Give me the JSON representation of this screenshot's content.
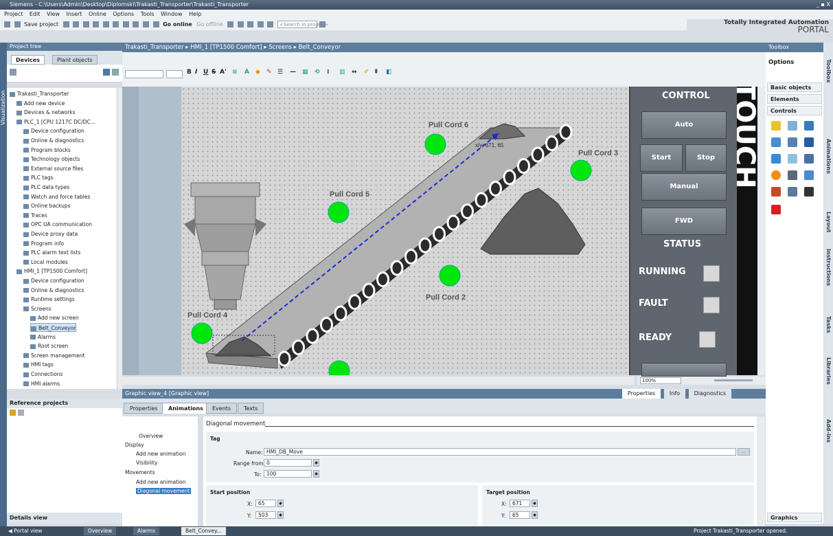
{
  "window": {
    "title": "Siemens - C:\\Users\\Admin\\Desktop\\Diplomski\\Trakasti_Transporter\\Trakasti_Transporter",
    "controls": "_ ▪ X"
  },
  "menu": [
    "Project",
    "Edit",
    "View",
    "Insert",
    "Online",
    "Options",
    "Tools",
    "Window",
    "Help"
  ],
  "toolbar": {
    "save": "Save project",
    "go_online": "Go online",
    "go_offline": "Go offline",
    "search_placeholder": "<Search in project>"
  },
  "branding": {
    "line1": "Totally Integrated Automation",
    "line2": "PORTAL"
  },
  "left_strip": "Visualization",
  "project_tree": {
    "title": "Project tree",
    "tabs": [
      "Devices",
      "Plant objects"
    ],
    "items": [
      "Trakasti_Transporter",
      "Add new device",
      "Devices & networks",
      "PLC_1 [CPU 1217C DC/DC...",
      "Device configuration",
      "Online & diagnostics",
      "Program blocks",
      "Technology objects",
      "External source files",
      "PLC tags",
      "PLC data types",
      "Watch and force tables",
      "Online backups",
      "Traces",
      "OPC UA communication",
      "Device proxy data",
      "Program info",
      "PLC alarm text lists",
      "Local modules",
      "HMI_1 [TP1500 Comfort]",
      "Device configuration",
      "Online & diagnostics",
      "Runtime settings",
      "Screens",
      "Add new screen",
      "Belt_Conveyor",
      "Alarms",
      "Root screen",
      "Screen management",
      "HMI tags",
      "Connections",
      "HMI alarms"
    ]
  },
  "reference_projects": "Reference projects",
  "details_view": "Details view",
  "breadcrumb": "Trakasti_Transporter  ▸  HMI_1 [TP1500 Comfort]  ▸  Screens  ▸  Belt_Conveyor",
  "hmi": {
    "pull_cords": [
      "Pull Cord 6",
      "Pull Cord 3",
      "Pull Cord 5",
      "Pull Cord 2",
      "Pull Cord 4"
    ],
    "xy_label": "x/y: 671, 65",
    "control_title": "CONTROL",
    "buttons": {
      "auto": "Auto",
      "start": "Start",
      "stop": "Stop",
      "manual": "Manual",
      "fwd": "FWD"
    },
    "status_title": "STATUS",
    "status": [
      "RUNNING",
      "FAULT",
      "READY"
    ],
    "vertical_text": "TOUCH"
  },
  "zoom": "100%",
  "inspector": {
    "title": "Graphic view_4 [Graphic view]",
    "right_tabs": [
      "Properties",
      "Info",
      "Diagnostics"
    ],
    "tabs": [
      "Properties",
      "Animations",
      "Events",
      "Texts"
    ],
    "nav": [
      "Overview",
      "Display",
      "Add new animation",
      "Visibility",
      "Movements",
      "Add new animation",
      "Diagonal movement"
    ],
    "section": "Diagonal movement",
    "tag_group": "Tag",
    "name_label": "Name:",
    "name_value": "HMI_DB_Move",
    "range_from_label": "Range from:",
    "range_from_value": "0",
    "to_label": "To:",
    "to_value": "100",
    "start_title": "Start position",
    "start_x": "65",
    "start_y": "503",
    "target_title": "Target position",
    "target_x": "671",
    "target_y": "65",
    "x_label": "X:",
    "y_label": "Y:"
  },
  "toolbox": {
    "title": "Toolbox",
    "options": "Options",
    "sections": [
      "Basic objects",
      "Elements",
      "Controls"
    ],
    "graphics": "Graphics",
    "side_tabs": [
      "Toolbox",
      "Animations",
      "Layout",
      "Instructions",
      "Tasks",
      "Libraries",
      "Add-ins"
    ]
  },
  "taskbar": {
    "portal": "◀  Portal view",
    "items": [
      "Overview",
      "Alarms",
      "Belt_Convey..."
    ],
    "status": "Project Trakasti_Transporter opened."
  }
}
